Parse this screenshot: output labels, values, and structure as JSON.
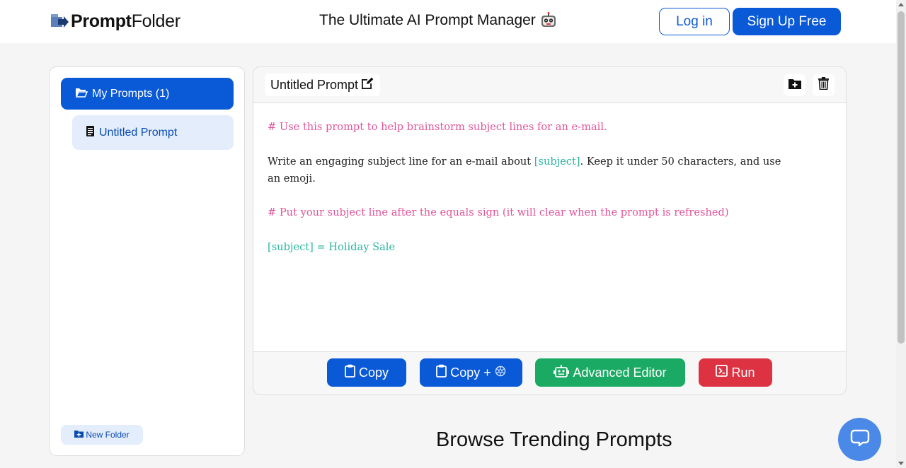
{
  "header": {
    "logo_bold": "Prompt",
    "logo_regular": "Folder",
    "tagline": "The Ultimate AI Prompt Manager",
    "login_label": "Log in",
    "signup_label": "Sign Up Free"
  },
  "sidebar": {
    "folder_label": "My Prompts (1)",
    "items": [
      {
        "label": "Untitled Prompt"
      }
    ],
    "new_folder_label": "New Folder"
  },
  "editor": {
    "title": "Untitled Prompt",
    "line1": "# Use this prompt to help brainstorm subject lines for an e-mail.",
    "line2a": "Write an engaging subject line for an e-mail about ",
    "line2var": "[subject]",
    "line2b": ". Keep it under 50 characters, and use",
    "line3": "an emoji.",
    "line4": "# Put your subject line after the equals sign (it will clear when the prompt is refreshed)",
    "line5": "[subject] = Holiday Sale",
    "actions": {
      "copy": "Copy",
      "copy_plus": "Copy +",
      "advanced": "Advanced Editor",
      "run": "Run"
    }
  },
  "section": {
    "trending_title": "Browse Trending Prompts"
  },
  "colors": {
    "primary": "#0a5ad7",
    "green": "#1aaa63",
    "red": "#dc3242",
    "comment": "#e0559a",
    "variable": "#2bb5a0"
  }
}
